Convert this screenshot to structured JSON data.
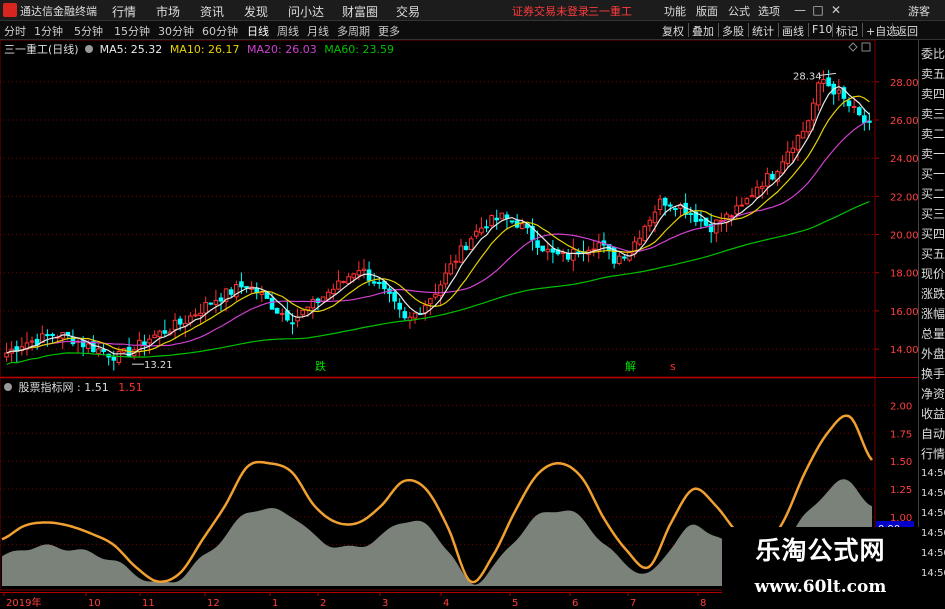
{
  "window": {
    "app_name": "通达信金融终端",
    "menu": [
      "行情",
      "市场",
      "资讯",
      "发现",
      "问小达",
      "财富圈",
      "交易"
    ],
    "notice": "证券交易未登录",
    "stock_title": "三一重工",
    "right_menu": [
      "功能",
      "版面",
      "公式",
      "选项",
      "游客"
    ],
    "controls": [
      "—",
      "□",
      "✕"
    ]
  },
  "period_bar": {
    "periods": [
      "分时",
      "1分钟",
      "5分钟",
      "15分钟",
      "30分钟",
      "60分钟",
      "日线",
      "周线",
      "月线",
      "多周期",
      "更多"
    ],
    "active": "日线",
    "tools": [
      "复权",
      "叠加",
      "多股",
      "统计",
      "画线",
      "F10",
      "标记",
      "+自选",
      "返回"
    ]
  },
  "main_legend": {
    "name": "三一重工(日线)",
    "ma": [
      {
        "label": "MA5: 25.32",
        "color": "#e8e8e8"
      },
      {
        "label": "MA10: 26.17",
        "color": "#e6d200"
      },
      {
        "label": "MA20: 26.03",
        "color": "#d040d0"
      },
      {
        "label": "MA60: 23.59",
        "color": "#00c000"
      }
    ]
  },
  "indicator_legend": {
    "name": "股票指标网 : 1.51",
    "value": "1.51"
  },
  "right_panel": {
    "items": [
      "委比",
      "卖五",
      "卖四",
      "卖三",
      "卖二",
      "卖一",
      "买一",
      "买二",
      "买三",
      "买四",
      "买五",
      "现价",
      "涨跌",
      "涨幅",
      "总量",
      "外盘",
      "换手",
      "净资",
      "收益",
      "自动",
      "行情",
      "14:50",
      "14:50",
      "14:50",
      "14:50",
      "14:50",
      "14:50"
    ]
  },
  "watermark": {
    "title": "乐淘公式网",
    "url": "www.60lt.com"
  },
  "colors": {
    "up": "#ff3232",
    "down": "#00ffff",
    "ma5": "#e8e8e8",
    "ma10": "#e6d200",
    "ma20": "#d040d0",
    "ma60": "#00c000",
    "indicator": "#f0a030",
    "area": "#7a827a",
    "grid": "#7a0000"
  },
  "chart_data": [
    {
      "type": "candlestick",
      "title": "三一重工(日线)",
      "y_axis_ticks": [
        "28.00",
        "26.00",
        "24.00",
        "22.00",
        "20.00",
        "18.00",
        "16.00",
        "14.00"
      ],
      "ylim": [
        12.8,
        29.3
      ],
      "annotations": [
        {
          "label": "28.34"
        },
        {
          "label": "13.21"
        }
      ],
      "signals": [
        {
          "label": "跌"
        },
        {
          "label": "解"
        },
        {
          "label": "s"
        }
      ],
      "series": [
        {
          "name": "MA5",
          "value": 25.32
        },
        {
          "name": "MA10",
          "value": 26.17
        },
        {
          "name": "MA20",
          "value": 26.03
        },
        {
          "name": "MA60",
          "value": 23.59
        }
      ],
      "close_path": [
        13.8,
        14.3,
        14.5,
        14.8,
        14.6,
        14.2,
        13.9,
        13.6,
        14.0,
        14.6,
        15.0,
        15.4,
        16.0,
        16.6,
        17.0,
        17.4,
        16.8,
        16.0,
        15.6,
        16.2,
        16.9,
        17.5,
        18.3,
        17.6,
        16.6,
        15.4,
        16.2,
        17.2,
        18.6,
        19.8,
        20.6,
        20.9,
        20.6,
        19.8,
        19.0,
        18.8,
        19.3,
        19.6,
        18.7,
        19.2,
        20.6,
        21.8,
        21.6,
        21.0,
        20.4,
        20.9,
        21.4,
        22.6,
        23.2,
        24.6,
        25.6,
        28.2,
        27.4,
        26.5,
        25.6
      ]
    },
    {
      "type": "line",
      "title": "股票指标网",
      "y_axis_ticks": [
        "2.00",
        "1.75",
        "1.50",
        "1.25",
        "1.00",
        "0.75"
      ],
      "ylim": [
        0.38,
        2.12
      ],
      "current_value_label": "0.90",
      "series": [
        {
          "name": "股票指标网",
          "values": [
            0.8,
            0.92,
            0.95,
            0.92,
            0.85,
            0.75,
            0.55,
            0.42,
            0.5,
            0.8,
            1.1,
            1.45,
            1.48,
            1.4,
            1.1,
            0.95,
            0.95,
            1.1,
            1.32,
            1.25,
            0.9,
            0.42,
            0.65,
            1.05,
            1.38,
            1.48,
            1.35,
            0.98,
            0.7,
            0.55,
            0.95,
            1.25,
            1.1,
            0.85,
            0.7,
            0.95,
            1.4,
            1.75,
            1.9,
            1.51
          ]
        }
      ]
    }
  ],
  "x_axis_labels": [
    "2019年",
    "10",
    "11",
    "12",
    "1",
    "2",
    "3",
    "4",
    "5",
    "6",
    "7",
    "8"
  ]
}
